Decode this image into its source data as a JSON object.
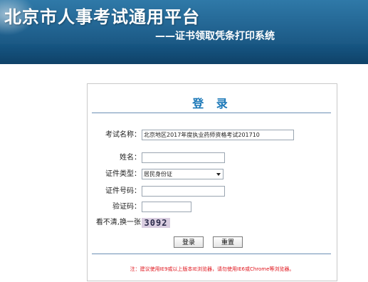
{
  "header": {
    "title": "北京市人事考试通用平台",
    "subtitle": "——证书领取凭条打印系统"
  },
  "login": {
    "heading": "登 录",
    "fields": {
      "exam_name": {
        "label": "考试名称：",
        "value": "北京地区2017年度执业药师资格考试201710"
      },
      "name": {
        "label": "姓名：",
        "value": ""
      },
      "id_type": {
        "label": "证件类型：",
        "value": "居民身份证"
      },
      "id_number": {
        "label": "证件号码：",
        "value": ""
      },
      "captcha": {
        "label": "验证码：",
        "value": ""
      }
    },
    "refresh_captcha": "看不清,换一张",
    "captcha_text": "3092",
    "login_button": "登录",
    "reset_button": "重置",
    "notice": "注：建议使用IE9或以上版本IE浏览器，请勿使用IE6或Chrome等浏览器。"
  }
}
